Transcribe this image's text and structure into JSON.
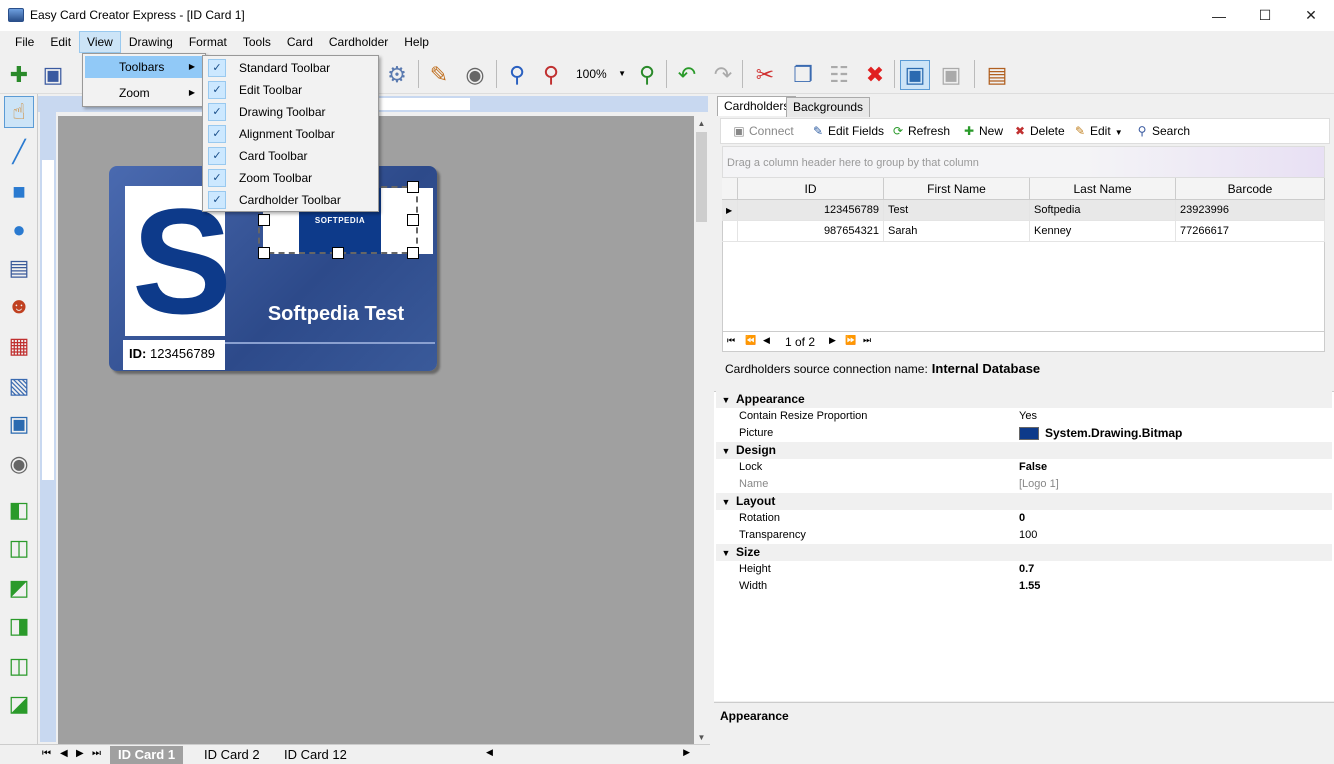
{
  "window": {
    "title": "Easy Card Creator Express - [ID Card 1]"
  },
  "menubar": [
    "File",
    "Edit",
    "View",
    "Drawing",
    "Format",
    "Tools",
    "Card",
    "Cardholder",
    "Help"
  ],
  "view_menu": [
    {
      "label": "Toolbars",
      "has_submenu": true,
      "active": true
    },
    {
      "label": "Zoom",
      "has_submenu": true,
      "active": false
    }
  ],
  "toolbars_submenu": [
    {
      "label": "Standard Toolbar",
      "checked": true
    },
    {
      "label": "Edit Toolbar",
      "checked": true
    },
    {
      "label": "Drawing Toolbar",
      "checked": true
    },
    {
      "label": "Alignment Toolbar",
      "checked": true
    },
    {
      "label": "Card Toolbar",
      "checked": true
    },
    {
      "label": "Zoom Toolbar",
      "checked": true
    },
    {
      "label": "Cardholder Toolbar",
      "checked": true
    }
  ],
  "toolbar": {
    "zoom": "100%"
  },
  "card": {
    "name": "Softpedia Test",
    "id_label": "ID:",
    "id_value": "123456789",
    "logo_text": "SOFTPEDIA"
  },
  "sheet_tabs": [
    "ID Card 1",
    "ID Card 2",
    "ID Card 12"
  ],
  "right_tabs": [
    "Cardholders",
    "Backgrounds"
  ],
  "grid_toolbar": {
    "connect": "Connect",
    "edit_fields": "Edit Fields",
    "refresh": "Refresh",
    "new": "New",
    "delete": "Delete",
    "edit": "Edit",
    "search": "Search"
  },
  "group_hint": "Drag a column header here to group by that column",
  "grid": {
    "columns": [
      "ID",
      "First Name",
      "Last Name",
      "Barcode"
    ],
    "rows": [
      [
        "123456789",
        "Test",
        "Softpedia",
        "23923996"
      ],
      [
        "987654321",
        "Sarah",
        "Kenney",
        "77266617"
      ]
    ]
  },
  "pager": {
    "text": "1 of 2"
  },
  "source": {
    "label": "Cardholders source connection name:",
    "value": "Internal Database"
  },
  "properties": {
    "appearance": "Appearance",
    "contain_resize_label": "Contain Resize Proportion",
    "contain_resize_value": "Yes",
    "picture_label": "Picture",
    "picture_value": "System.Drawing.Bitmap",
    "design": "Design",
    "lock_label": "Lock",
    "lock_value": "False",
    "name_label": "Name",
    "name_value": "[Logo 1]",
    "layout": "Layout",
    "rotation_label": "Rotation",
    "rotation_value": "0",
    "transparency_label": "Transparency",
    "transparency_value": "100",
    "size": "Size",
    "height_label": "Height",
    "height_value": "0.7",
    "width_label": "Width",
    "width_value": "1.55"
  },
  "description": {
    "title": "Appearance"
  }
}
